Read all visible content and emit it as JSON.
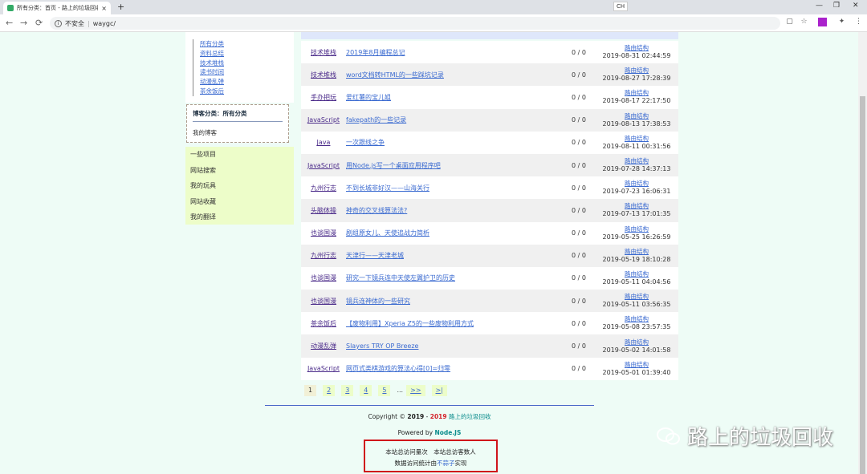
{
  "browser": {
    "tab_title": "所有分类：首页 - 路上的垃圾回收",
    "tab_close": "×",
    "new_tab": "+",
    "ime_label": "CH",
    "url_security": "不安全",
    "url": "waygc/",
    "back": "←",
    "forward": "→",
    "reload": "C"
  },
  "sidebar": {
    "categories": [
      "所有分类",
      "资料总结",
      "技术堆栈",
      "读书时间",
      "动漫乱弹",
      "茶余饭后"
    ],
    "blog_heading": "博客分类：所有分类",
    "my_blog": "我的博客",
    "menu": [
      "一些项目",
      "网站搜索",
      "我的玩具",
      "网站收藏",
      "我的翻译"
    ]
  },
  "posts": [
    {
      "cat": "技术堆栈",
      "title": "2019年8月编程总记",
      "count": "0 / 0",
      "author": "路由结构",
      "date": "2019-08-31 02:44:59"
    },
    {
      "cat": "技术堆栈",
      "title": "word文档转HTML的一些踩坑记录",
      "count": "0 / 0",
      "author": "路由结构",
      "date": "2019-08-27 17:28:39"
    },
    {
      "cat": "手办把玩",
      "title": "爱红薯的宝儿姐",
      "count": "0 / 0",
      "author": "路由结构",
      "date": "2019-08-17 22:17:50"
    },
    {
      "cat": "JavaScript",
      "title": "fakepath的一些记录",
      "count": "0 / 0",
      "author": "路由结构",
      "date": "2019-08-13 17:38:53"
    },
    {
      "cat": "Java",
      "title": "一次跟线之争",
      "count": "0 / 0",
      "author": "路由结构",
      "date": "2019-08-11 00:31:56"
    },
    {
      "cat": "JavaScript",
      "title": "用Node.js写一个桌面应用程序吧",
      "count": "0 / 0",
      "author": "路由结构",
      "date": "2019-07-28 14:37:13"
    },
    {
      "cat": "九州行志",
      "title": "不到长城非好汉——山海关行",
      "count": "0 / 0",
      "author": "路由结构",
      "date": "2019-07-23 16:06:31"
    },
    {
      "cat": "头脑体操",
      "title": "神奇的交叉线算法法?",
      "count": "0 / 0",
      "author": "路由结构",
      "date": "2019-07-13 17:01:35"
    },
    {
      "cat": "也谈国漫",
      "title": "剧组原女儿、天使追战力简析",
      "count": "0 / 0",
      "author": "路由结构",
      "date": "2019-05-25 16:26:59"
    },
    {
      "cat": "九州行志",
      "title": "天津行——天津老城",
      "count": "0 / 0",
      "author": "路由结构",
      "date": "2019-05-19 18:10:28"
    },
    {
      "cat": "也谈国漫",
      "title": "研究一下镜兵连中天使左翼护卫的历史",
      "count": "0 / 0",
      "author": "路由结构",
      "date": "2019-05-11 04:04:56"
    },
    {
      "cat": "也谈国漫",
      "title": "镜兵连神体的一些研究",
      "count": "0 / 0",
      "author": "路由结构",
      "date": "2019-05-11 03:56:35"
    },
    {
      "cat": "茶余饭后",
      "title": "【废物利用】Xperia Z5的一些废物利用方式",
      "count": "0 / 0",
      "author": "路由结构",
      "date": "2019-05-08 23:57:35"
    },
    {
      "cat": "动漫乱弹",
      "title": "Slayers TRY OP Breeze",
      "count": "0 / 0",
      "author": "路由结构",
      "date": "2019-05-02 14:01:58"
    },
    {
      "cat": "JavaScript",
      "title": "网页式类棋游戏的算法心得[0]=归零",
      "count": "0 / 0",
      "author": "路由结构",
      "date": "2019-05-01 01:39:40"
    }
  ],
  "pager": {
    "items": [
      "1",
      "2",
      "3",
      "4",
      "5",
      "...",
      ">>",
      ">|"
    ]
  },
  "footer": {
    "copyright_prefix": "Copyright © ",
    "year_a": "2019",
    "dash": " - ",
    "year_b": "2019",
    "site": "路上的垃圾回收",
    "powered": "Powered by ",
    "nodejs": "Node.JS",
    "stat_line1": "本站总访问量次　本站总访客数人",
    "stat_line2_a": "数据访问统计由",
    "stat_link": "不蒜子",
    "stat_line2_b": "实现"
  },
  "watermark": "路上的垃圾回收"
}
